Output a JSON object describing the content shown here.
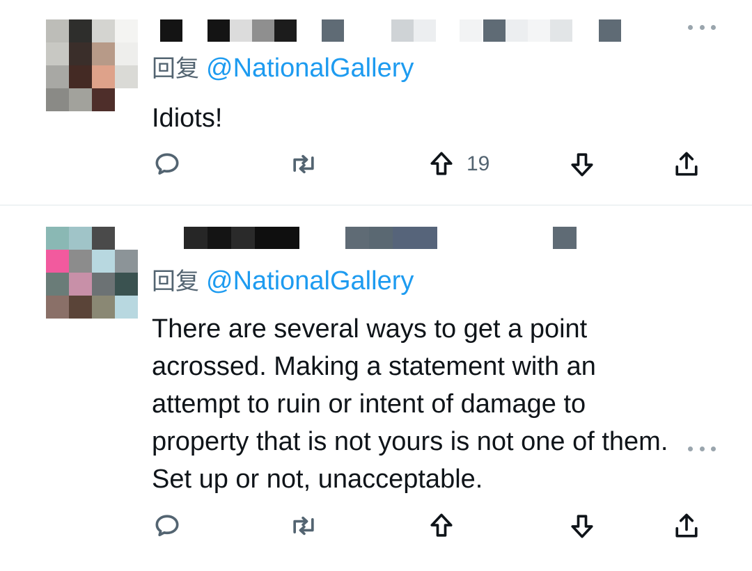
{
  "thread": {
    "reply_prefix": "回复",
    "tweets": [
      {
        "mention": "@NationalGallery",
        "text": "Idiots!",
        "upvote_count": "19"
      },
      {
        "mention": "@NationalGallery",
        "text": "There are several ways to get a point acrossed. Making a statement with an attempt to ruin or intent of damage to property that is not yours is not one of them. Set up or not, unacceptable.",
        "upvote_count": ""
      }
    ]
  },
  "icons": {
    "reply": "comment-bubble-icon",
    "retweet": "retweet-icon",
    "upvote": "arrow-up-icon",
    "downvote": "arrow-down-icon",
    "share": "share-icon",
    "more": "more-dots-icon"
  },
  "colors": {
    "mention": "#1d9bf0",
    "secondary_text": "#536471",
    "primary_text": "#0f1419",
    "divider": "#eff3f4"
  }
}
